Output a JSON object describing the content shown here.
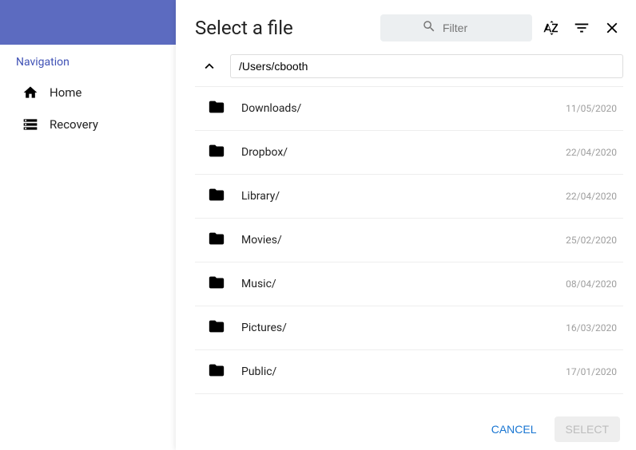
{
  "sidebar": {
    "title": "Navigation",
    "items": [
      {
        "label": "Home"
      },
      {
        "label": "Recovery"
      }
    ]
  },
  "dialog": {
    "title": "Select a file",
    "filter_placeholder": "Filter",
    "current_path": "/Users/cbooth",
    "files": [
      {
        "name": "Downloads/",
        "date": "11/05/2020"
      },
      {
        "name": "Dropbox/",
        "date": "22/04/2020"
      },
      {
        "name": "Library/",
        "date": "22/04/2020"
      },
      {
        "name": "Movies/",
        "date": "25/02/2020"
      },
      {
        "name": "Music/",
        "date": "08/04/2020"
      },
      {
        "name": "Pictures/",
        "date": "16/03/2020"
      },
      {
        "name": "Public/",
        "date": "17/01/2020"
      }
    ],
    "cancel_label": "Cancel",
    "select_label": "Select"
  }
}
